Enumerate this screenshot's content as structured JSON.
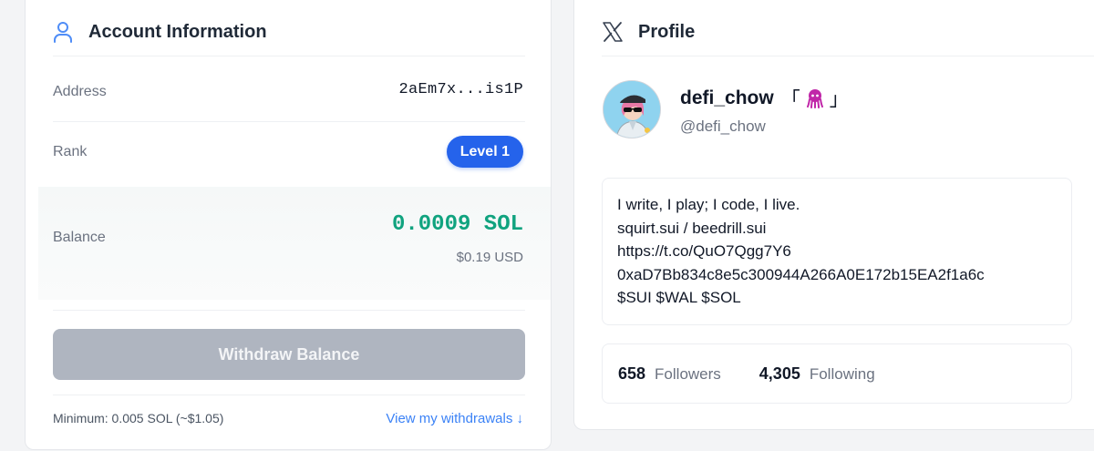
{
  "account": {
    "title": "Account Information",
    "address_label": "Address",
    "address_value": "2aEm7x...is1P",
    "rank_label": "Rank",
    "rank_value": "Level 1",
    "balance_label": "Balance",
    "balance_sol": "0.0009 SOL",
    "balance_usd": "$0.19 USD",
    "withdraw_button": "Withdraw Balance",
    "minimum_text": "Minimum: 0.005 SOL (~$1.05)",
    "withdrawals_link": "View my withdrawals ↓"
  },
  "profile": {
    "title": "Profile",
    "display_name": "defi_chow",
    "name_bracket_open": "「",
    "name_bracket_close": "」",
    "handle": "@defi_chow",
    "bio": [
      "I write, I play; I code, I live.",
      "squirt.sui / beedrill.sui",
      "https://t.co/QuO7Qgg7Y6",
      "0xaD7Bb834c8e5c300944A266A0E172b15EA2f1a6c",
      "$SUI $WAL $SOL"
    ],
    "followers_count": "658",
    "followers_label": "Followers",
    "following_count": "4,305",
    "following_label": "Following"
  },
  "icons": {
    "account_header": "user-icon",
    "profile_header": "x-logo-icon",
    "name_emoji": "squid-icon"
  },
  "colors": {
    "accent_blue": "#2563eb",
    "balance_green": "#10a37f",
    "link_blue": "#3b82f6",
    "disabled_button": "#afb5c0"
  }
}
